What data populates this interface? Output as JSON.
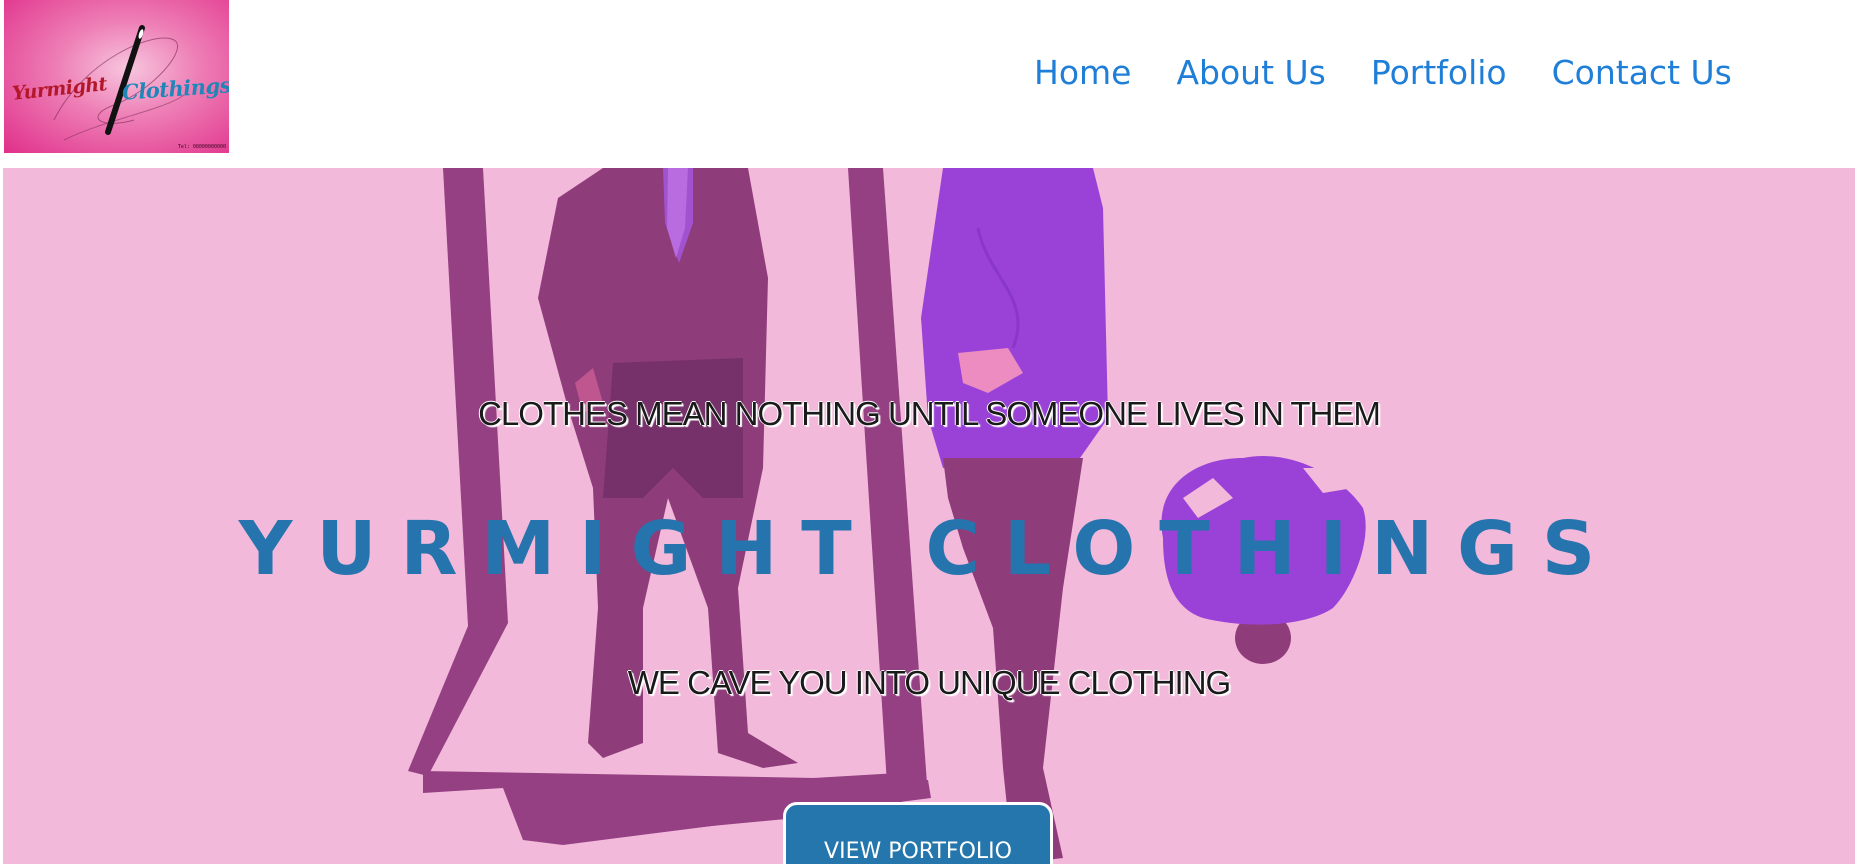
{
  "brand": {
    "logo_text_1": "Yurmight",
    "logo_text_2": "Clothings",
    "logo_tel": "Tel: 08000000000"
  },
  "nav": {
    "items": [
      {
        "label": "Home"
      },
      {
        "label": "About Us"
      },
      {
        "label": "Portfolio"
      },
      {
        "label": "Contact Us"
      }
    ]
  },
  "hero": {
    "tagline_top": "CLOTHES MEAN NOTHING UNTIL SOMEONE LIVES IN THEM",
    "title": "YURMIGHT CLOTHINGS",
    "tagline_bottom": "WE CAVE YOU INTO UNIQUE CLOTHING",
    "cta_label": "VIEW PORTFOLIO"
  },
  "colors": {
    "nav_link": "#1f7fd8",
    "hero_bg": "#f2b9da",
    "title": "#2674ad",
    "cta_bg": "#2476ac",
    "figure_mauve": "#8f3c7b",
    "figure_purple": "#9a42d8"
  }
}
